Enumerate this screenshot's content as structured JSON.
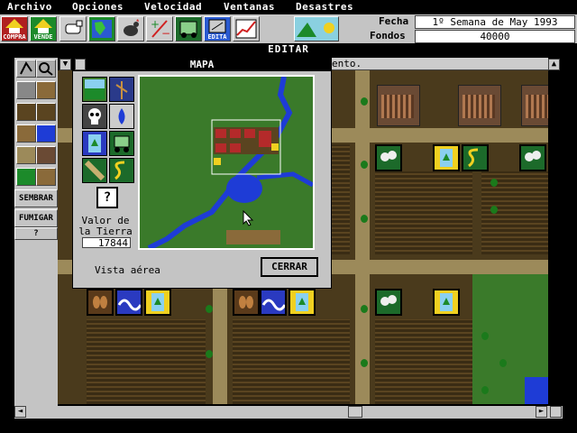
{
  "menu": [
    "Archivo",
    "Opciones",
    "Velocidad",
    "Ventanas",
    "Desastres"
  ],
  "toolbar": {
    "compra_label": "COMPRA",
    "vende_label": "VENDE",
    "edita_label": "EDITA",
    "fecha_label": "Fecha",
    "fecha_value": "1º Semana de May 1993",
    "fondos_label": "Fondos",
    "fondos_value": "40000"
  },
  "editor_title": "EDITAR",
  "message_fragment": "ento.",
  "left_tools": {
    "sembrar": "SEMBRAR",
    "fumigar": "FUMIGAR",
    "help": "?"
  },
  "map_window": {
    "title": "MAPA",
    "help": "?",
    "valor_label": "Valor de la Tierra",
    "valor_value": "17844",
    "vista": "Vista aérea",
    "cerrar": "CERRAR"
  },
  "colors": {
    "panel": "#c4c4c4",
    "grass": "#3a7a2a",
    "soil": "#4a3a1c",
    "water": "#1e3cd6",
    "barn": "#b42a2a"
  }
}
